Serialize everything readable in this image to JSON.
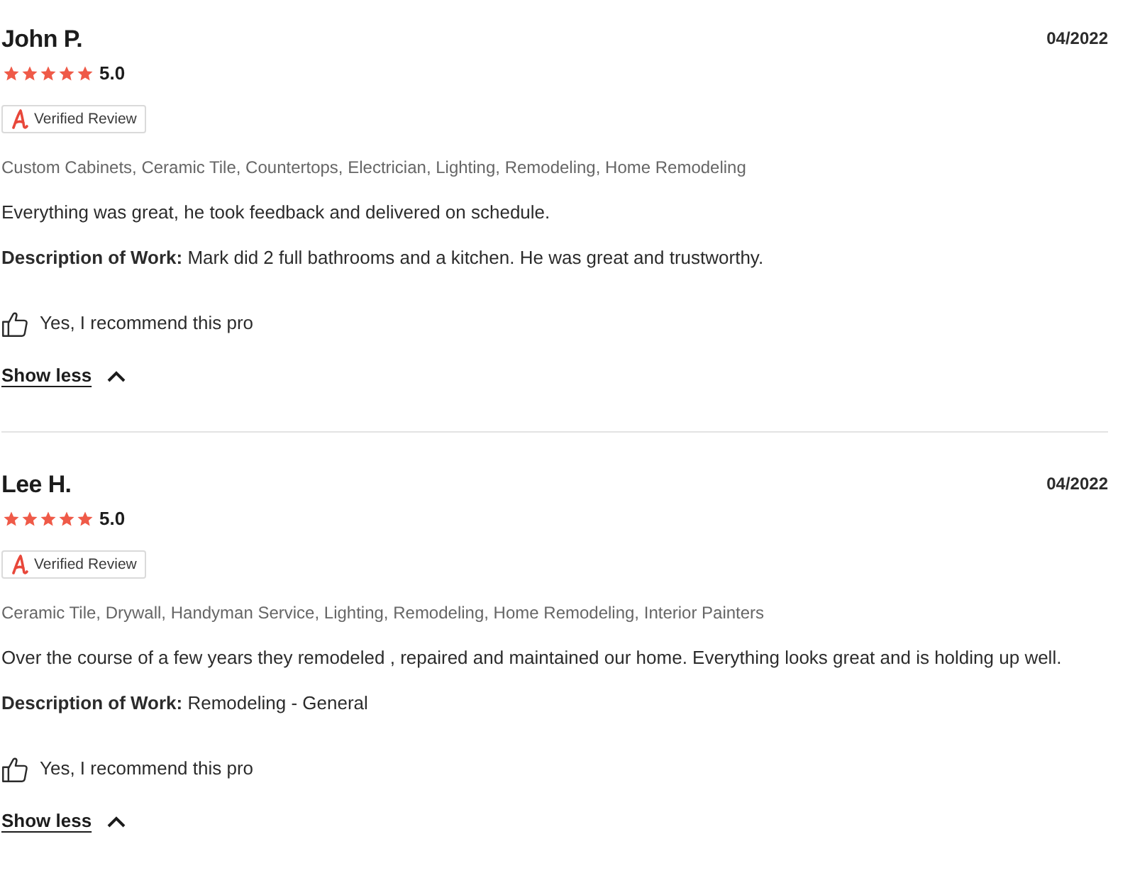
{
  "reviews": [
    {
      "name": "John P.",
      "date": "04/2022",
      "stars": 5,
      "rating": "5.0",
      "badge": "Verified Review",
      "categories": "Custom Cabinets, Ceramic Tile, Countertops, Electrician, Lighting, Remodeling, Home Remodeling",
      "comment": "Everything was great, he took feedback and delivered on schedule.",
      "description": "**Description of Work:** Mark did 2 full bathrooms and a kitchen. He was great and trustworthy.",
      "recommendation": "Yes, I recommend this pro",
      "toggle": "Show less",
      "expanded": true
    },
    {
      "name": "Lee H.",
      "date": "04/2022",
      "stars": 5,
      "rating": "5.0",
      "badge": "Verified Review",
      "categories": "Ceramic Tile, Drywall, Handyman Service, Lighting, Remodeling, Home Remodeling, Interior Painters",
      "comment": "Over the course of a few years they remodeled , repaired and maintained our home. Everything looks great and is holding up well.",
      "description": "**Description of Work:** Remodeling - General",
      "recommendation": "Yes, I recommend this pro",
      "toggle": "Show less",
      "expanded": true
    }
  ]
}
